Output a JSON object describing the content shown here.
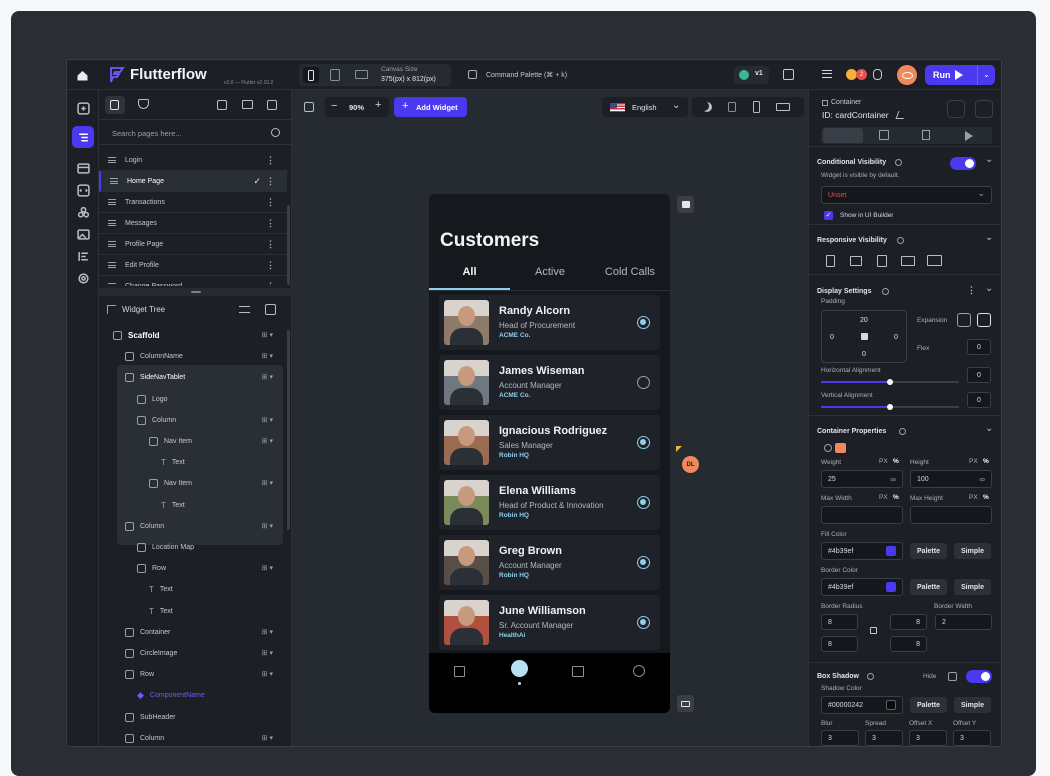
{
  "app": {
    "logo_text": "Flutterflow",
    "version": "v2.0 — Flutter v2.10.2",
    "canvas_size_label": "Canvas Size",
    "canvas_size_value": "375(px) x 812(px)",
    "command_palette": "Command Palette (⌘ + k)",
    "branch_version": "v1",
    "badge_orange_count": "2",
    "run_label": "Run"
  },
  "left": {
    "search_placeholder": "Search pages here...",
    "pages": [
      "Login",
      "Home Page",
      "Transactions",
      "Messages",
      "Profile Page",
      "Edit Profile",
      "Change Password"
    ],
    "widget_tree_title": "Widget Tree",
    "tree": [
      {
        "label": "Scaffold",
        "indent": 0,
        "bold": true
      },
      {
        "label": "ColumnName",
        "indent": 1
      },
      {
        "label": "SideNavTablet",
        "indent": 1,
        "selected": true
      },
      {
        "label": "Logo",
        "indent": 2
      },
      {
        "label": "Column",
        "indent": 2
      },
      {
        "label": "Nav Item",
        "indent": 3
      },
      {
        "label": "Text",
        "indent": 4
      },
      {
        "label": "Nav Item",
        "indent": 3
      },
      {
        "label": "Text",
        "indent": 4
      },
      {
        "label": "Column",
        "indent": 1
      },
      {
        "label": "Location Map",
        "indent": 2
      },
      {
        "label": "Row",
        "indent": 2
      },
      {
        "label": "Text",
        "indent": 3
      },
      {
        "label": "Text",
        "indent": 3
      },
      {
        "label": "Container",
        "indent": 1
      },
      {
        "label": "CircleImage",
        "indent": 1
      },
      {
        "label": "Row",
        "indent": 1
      },
      {
        "label": "ComponentName",
        "indent": 2,
        "purple": true
      },
      {
        "label": "SubHeader",
        "indent": 1
      },
      {
        "label": "Column",
        "indent": 1
      }
    ]
  },
  "canvas": {
    "zoom": "90%",
    "add_widget": "Add Widget",
    "language": "English",
    "dl_badge": "DL"
  },
  "phone": {
    "title": "Customers",
    "tabs": [
      "All",
      "Active",
      "Cold Calls"
    ],
    "customers": [
      {
        "name": "Randy Alcorn",
        "role": "Head of Procurement",
        "company": "ACME Co.",
        "icon": "radio-selected"
      },
      {
        "name": "James Wiseman",
        "role": "Account Manager",
        "company": "ACME Co.",
        "icon": "hidden"
      },
      {
        "name": "Ignacious Rodriguez",
        "role": "Sales Manager",
        "company": "Robin HQ",
        "icon": "radio-selected"
      },
      {
        "name": "Elena Williams",
        "role": "Head of Product & Innovation",
        "company": "Robin HQ",
        "icon": "radio-selected"
      },
      {
        "name": "Greg Brown",
        "role": "Account Manager",
        "company": "Robin HQ",
        "icon": "radio-selected"
      },
      {
        "name": "June Williamson",
        "role": "Sr. Account Manager",
        "company": "HealthAi",
        "icon": "radio-selected"
      }
    ]
  },
  "right": {
    "widget_type": "Container",
    "widget_id": "ID: cardContainer",
    "conditional_visibility": "Conditional Visibility",
    "visible_note": "Widget is visible by default.",
    "unset": "Unset",
    "show_in_builder": "Show in UI Builder",
    "responsive_visibility": "Responsive Visibility",
    "display_settings": "Display Settings",
    "padding": "Padding",
    "pad_top": "20",
    "pad_left": "0",
    "pad_right": "0",
    "pad_bottom": "0",
    "expansion": "Expansion",
    "flex": "Flex",
    "flex_value": "0",
    "h_align": "Horizontal Alignment",
    "h_align_value": "0",
    "v_align": "Vertical Alignment",
    "v_align_value": "0",
    "container_properties": "Container Properties",
    "weight": "Weight",
    "height": "Height",
    "px": "PX",
    "pct": "%",
    "weight_value": "25",
    "height_value": "100",
    "inf": "∞",
    "max_width": "Max Width",
    "max_height": "Max Height",
    "fill_color": "Fill Color",
    "fill_value": "#4b39ef",
    "palette": "Palette",
    "simple": "Simple",
    "border_color": "Border Color",
    "border_value": "#4b39ef",
    "border_radius": "Border Radius",
    "border_width": "Border Width",
    "br_tl": "8",
    "br_tr": "8",
    "br_bl": "8",
    "br_br": "8",
    "bw_value": "2",
    "box_shadow": "Box Shadow",
    "hide": "Hide",
    "shadow_color": "Shadow Color",
    "shadow_value": "#00000242",
    "blur": "Blur",
    "spread": "Spread",
    "offset_x": "Offset X",
    "offset_y": "Offset Y",
    "blur_v": "3",
    "spread_v": "3",
    "ox_v": "3",
    "oy_v": "3"
  },
  "colors": {
    "accent": "#4b39ef",
    "link": "#8fd0ef",
    "orange": "#f08a5d"
  }
}
